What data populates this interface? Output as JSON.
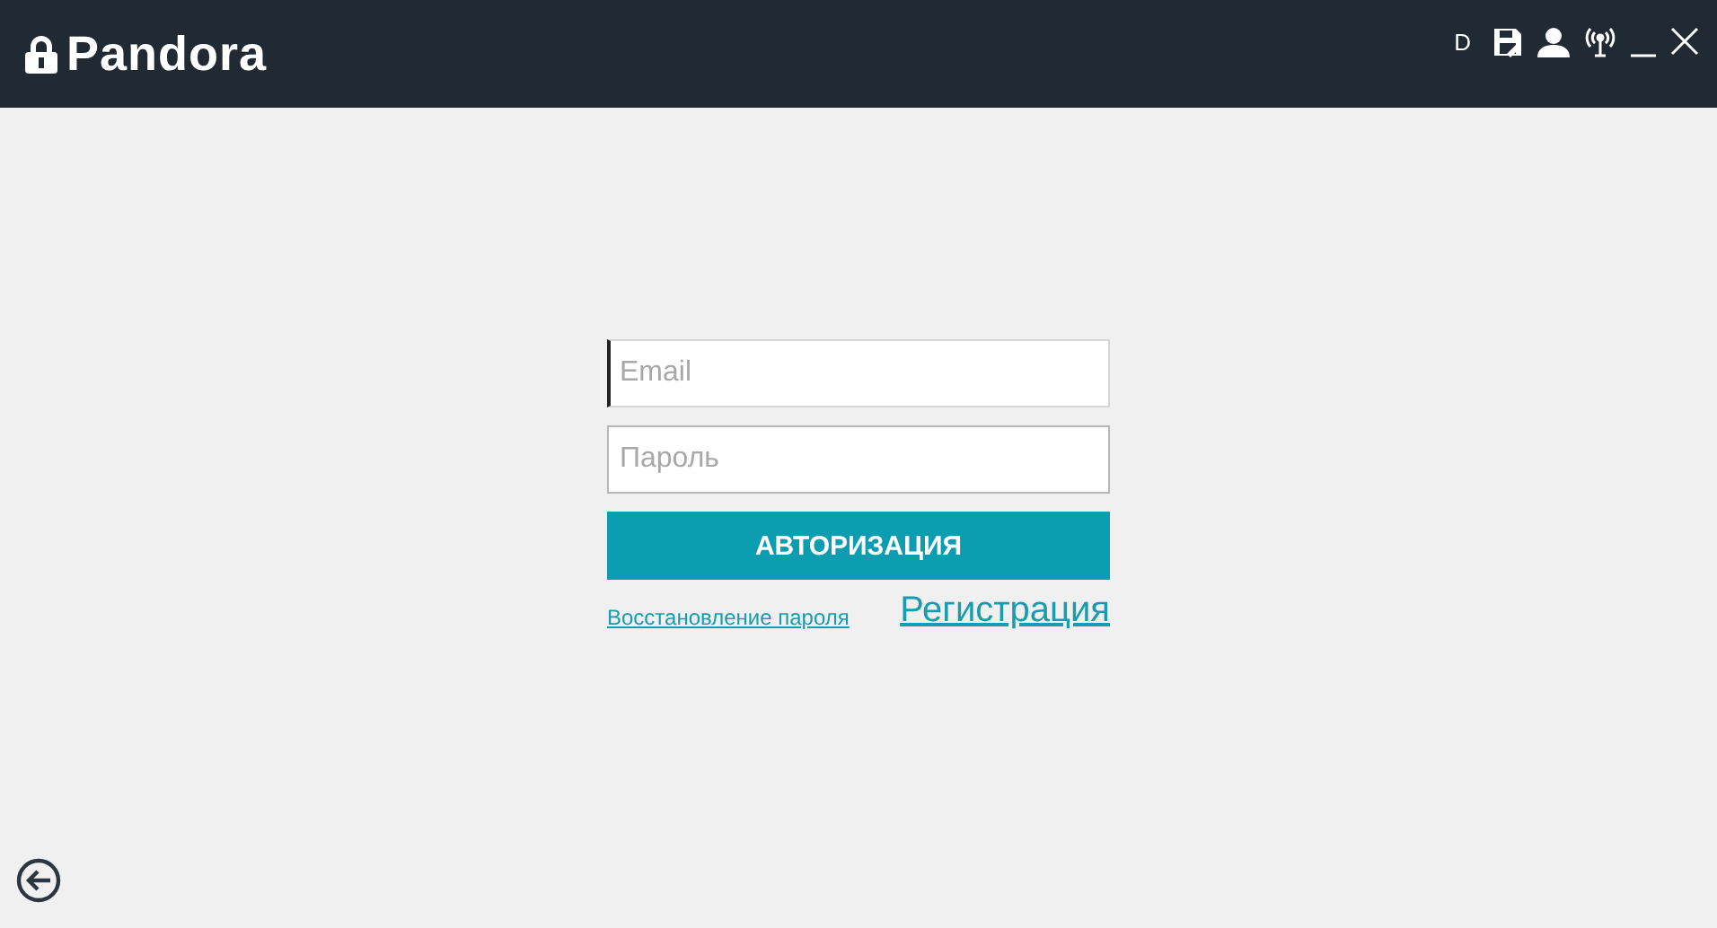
{
  "header": {
    "logo": "Pandora",
    "user_letter": "D"
  },
  "login": {
    "email": {
      "placeholder": "Email",
      "focused": true
    },
    "password": {
      "placeholder": "Пароль",
      "focused": false
    },
    "submit": "АВТОРИЗАЦИЯ",
    "recover_link": "Восстановление пароля",
    "register_link": "Регистрация"
  }
}
